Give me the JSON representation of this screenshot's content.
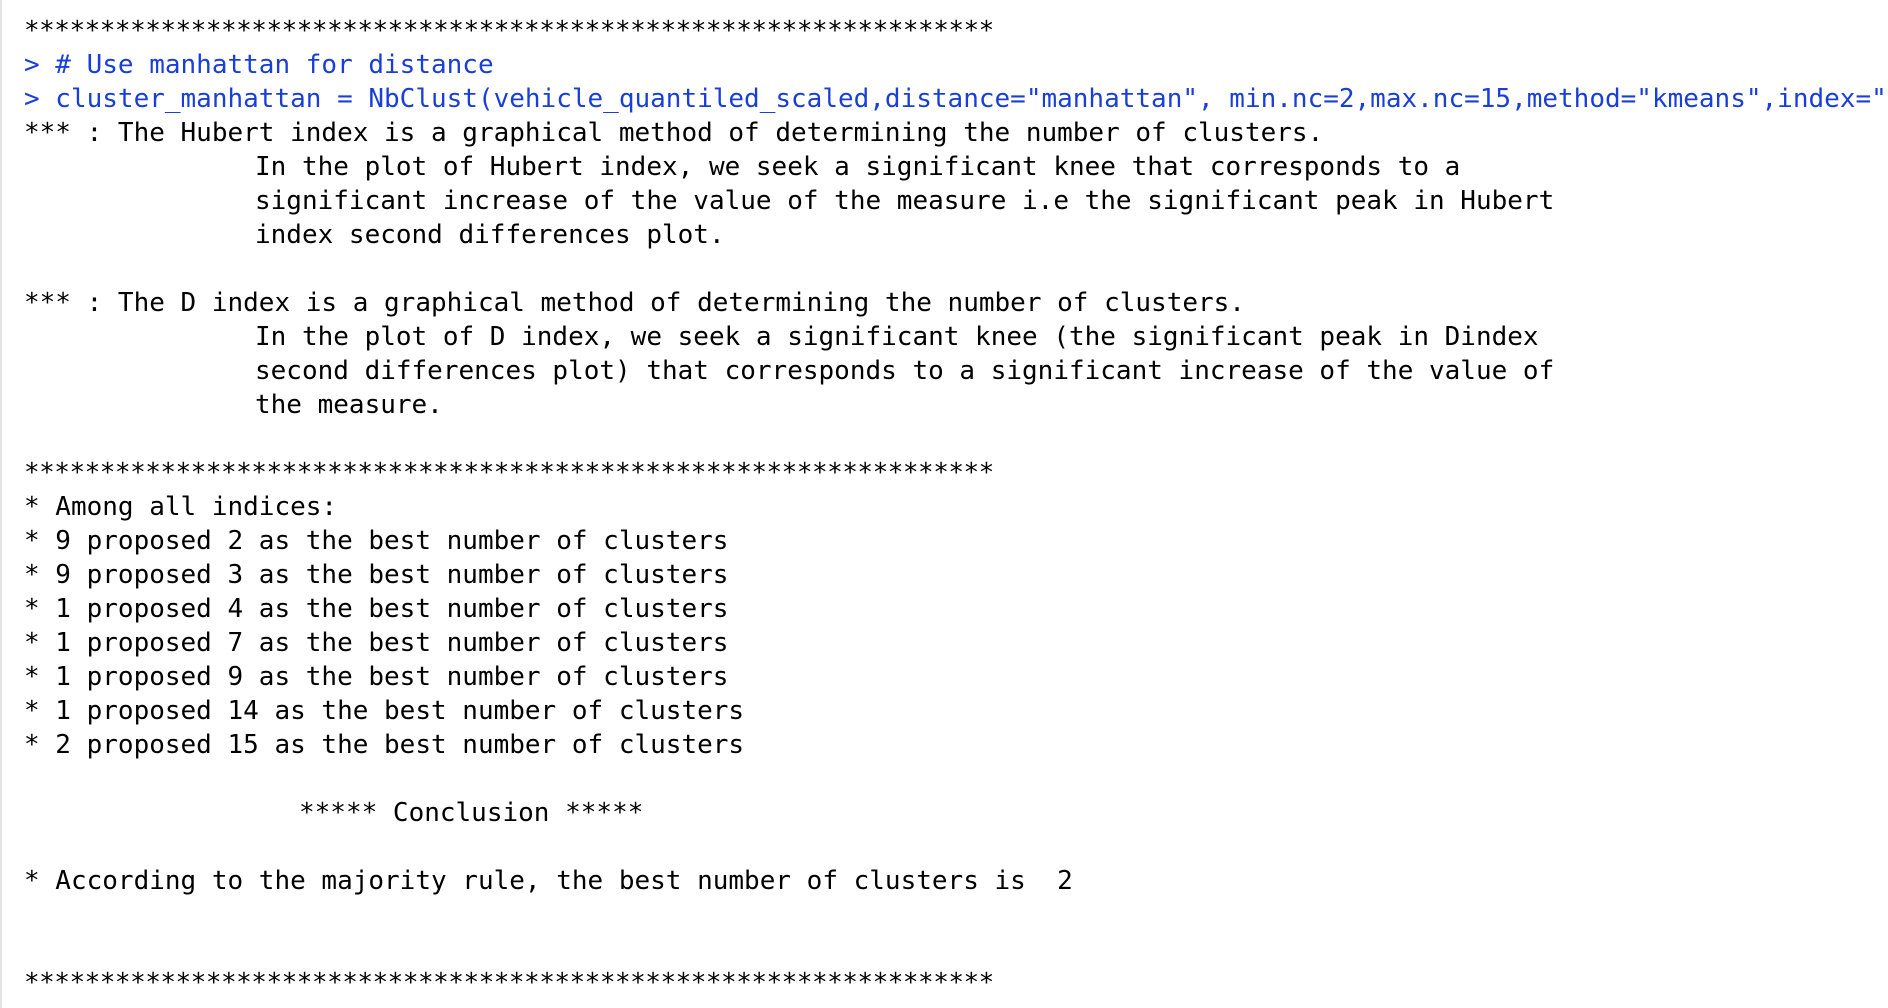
{
  "separator": "****************************************************************",
  "commands": [
    "> # Use manhattan for distance",
    "> cluster_manhattan = NbClust(vehicle_quantiled_scaled,distance=\"manhattan\", min.nc=2,max.nc=15,method=\"kmeans\",index=\"all\")"
  ],
  "hubert_note": {
    "head": "*** : The Hubert index is a graphical method of determining the number of clusters.",
    "body": [
      "In the plot of Hubert index, we seek a significant knee that corresponds to a",
      "significant increase of the value of the measure i.e the significant peak in Hubert",
      "index second differences plot."
    ]
  },
  "dindex_note": {
    "head": "*** : The D index is a graphical method of determining the number of clusters.",
    "body": [
      "In the plot of D index, we seek a significant knee (the significant peak in Dindex",
      "second differences plot) that corresponds to a significant increase of the value of",
      "the measure."
    ]
  },
  "summary": {
    "header": "* Among all indices:",
    "lines": [
      "* 9 proposed 2 as the best number of clusters",
      "* 9 proposed 3 as the best number of clusters",
      "* 1 proposed 4 as the best number of clusters",
      "* 1 proposed 7 as the best number of clusters",
      "* 1 proposed 9 as the best number of clusters",
      "* 1 proposed 14 as the best number of clusters",
      "* 2 proposed 15 as the best number of clusters"
    ]
  },
  "conclusion_title": "***** Conclusion *****",
  "conclusion_text": "* According to the majority rule, the best number of clusters is  2"
}
